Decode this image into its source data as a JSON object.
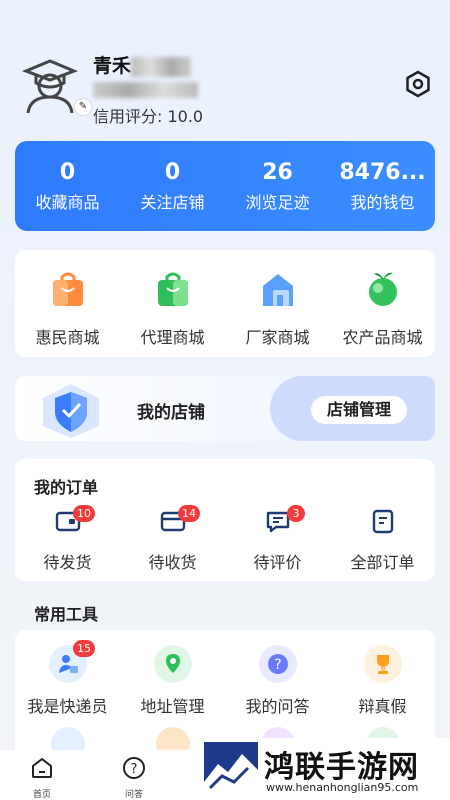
{
  "profile": {
    "name_visible": "青禾",
    "credit_label": "信用评分: 10.0"
  },
  "stats": [
    {
      "value": "0",
      "label": "收藏商品"
    },
    {
      "value": "0",
      "label": "关注店铺"
    },
    {
      "value": "26",
      "label": "浏览足迹"
    },
    {
      "value": "8476...",
      "label": "我的钱包"
    }
  ],
  "malls": [
    {
      "label": "惠民商城",
      "icon": "shopping-bag-orange-icon"
    },
    {
      "label": "代理商城",
      "icon": "shopping-bag-green-icon"
    },
    {
      "label": "厂家商城",
      "icon": "factory-house-icon"
    },
    {
      "label": "农产品商城",
      "icon": "vegetable-icon"
    }
  ],
  "shop": {
    "title": "我的店铺",
    "manage_label": "店铺管理"
  },
  "orders": {
    "title": "我的订单",
    "items": [
      {
        "label": "待发货",
        "badge": "10"
      },
      {
        "label": "待收货",
        "badge": "14"
      },
      {
        "label": "待评价",
        "badge": "3"
      },
      {
        "label": "全部订单",
        "badge": ""
      }
    ]
  },
  "tools": {
    "title": "常用工具",
    "items": [
      {
        "label": "我是快递员",
        "badge": "15"
      },
      {
        "label": "地址管理",
        "badge": ""
      },
      {
        "label": "我的问答",
        "badge": ""
      },
      {
        "label": "辩真假",
        "badge": ""
      }
    ]
  },
  "tabbar": {
    "home": "首页",
    "qa": "问答"
  },
  "watermark": {
    "title": "鸿联手游网",
    "url": "www.henanhonglian95.com"
  },
  "colors": {
    "primary": "#2f7bff",
    "badge": "#f23c3c"
  }
}
